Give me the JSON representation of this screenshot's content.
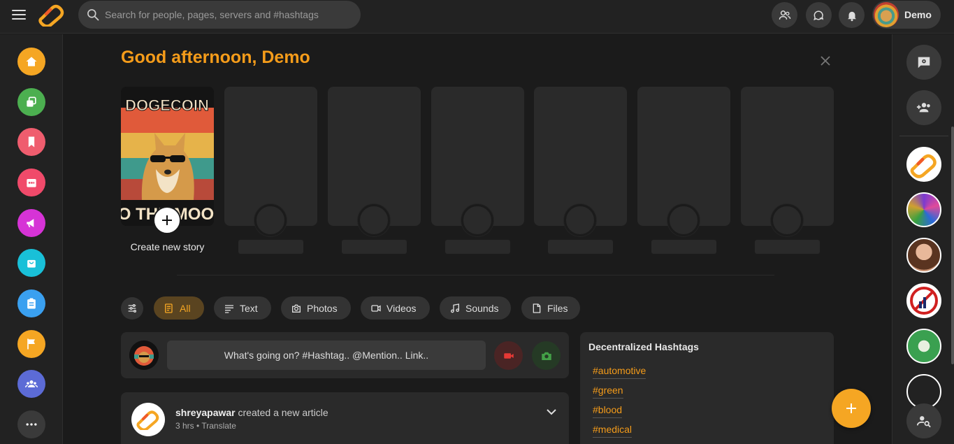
{
  "topbar": {
    "search_placeholder": "Search for people, pages, servers and #hashtags",
    "user_name": "Demo"
  },
  "left_nav": [
    {
      "icon": "home-icon",
      "color": "#f5a623"
    },
    {
      "icon": "layers-icon",
      "color": "#4caf50"
    },
    {
      "icon": "bookmark-icon",
      "color": "#ef5d6e"
    },
    {
      "icon": "calendar-icon",
      "color": "#f04a6a"
    },
    {
      "icon": "megaphone-icon",
      "color": "#d633d6"
    },
    {
      "icon": "shopping-bag-icon",
      "color": "#19c0d8"
    },
    {
      "icon": "clipboard-icon",
      "color": "#3aa0f0"
    },
    {
      "icon": "flag-icon",
      "color": "#f5a623"
    },
    {
      "icon": "groups-icon",
      "color": "#5c6bd6"
    },
    {
      "icon": "more-icon",
      "color": "#3a3a3a"
    }
  ],
  "main": {
    "greeting": "Good afternoon, Demo",
    "create_story_label": "Create new story",
    "filter_tabs": [
      {
        "label": "All",
        "icon": "article-icon",
        "active": true
      },
      {
        "label": "Text",
        "icon": "text-icon",
        "active": false
      },
      {
        "label": "Photos",
        "icon": "camera-icon",
        "active": false
      },
      {
        "label": "Videos",
        "icon": "video-icon",
        "active": false
      },
      {
        "label": "Sounds",
        "icon": "music-icon",
        "active": false
      },
      {
        "label": "Files",
        "icon": "file-icon",
        "active": false
      }
    ],
    "composer_placeholder": "What's going on? #Hashtag.. @Mention.. Link..",
    "post": {
      "author": "shreyapawar",
      "action": "created a new article",
      "time": "3 hrs",
      "translate": "Translate"
    },
    "hashtags": {
      "title": "Decentralized Hashtags",
      "items": [
        "#automotive",
        "#green",
        "#blood",
        "#medical"
      ]
    }
  },
  "colors": {
    "accent": "#f5a623",
    "background": "#1b1b1b",
    "panel": "#222222"
  }
}
